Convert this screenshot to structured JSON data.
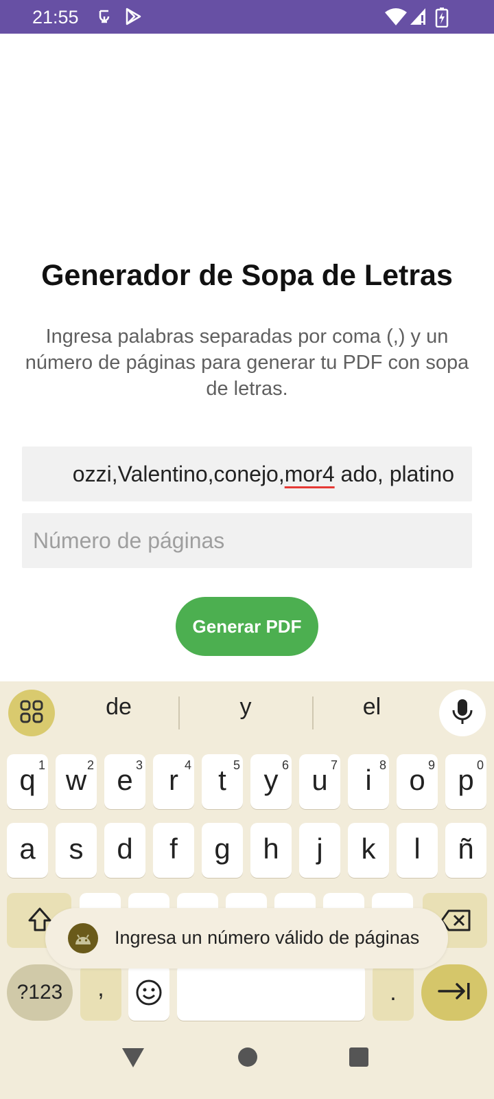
{
  "status_bar": {
    "time": "21:55"
  },
  "app": {
    "title": "Generador de Sopa de Letras",
    "subtitle": "Ingresa palabras separadas por coma (,) y un número de páginas para generar tu PDF con sopa de letras.",
    "words_input": {
      "value_pre": "ozzi,Valentino,conejo,",
      "value_underlined": "mor4",
      "value_post": " ado, platino"
    },
    "pages_input": {
      "placeholder": "Número de páginas",
      "value": ""
    },
    "generate_button": "Generar PDF"
  },
  "keyboard": {
    "suggestions": [
      "de",
      "y",
      "el"
    ],
    "row1": [
      {
        "char": "q",
        "num": "1"
      },
      {
        "char": "w",
        "num": "2"
      },
      {
        "char": "e",
        "num": "3"
      },
      {
        "char": "r",
        "num": "4"
      },
      {
        "char": "t",
        "num": "5"
      },
      {
        "char": "y",
        "num": "6"
      },
      {
        "char": "u",
        "num": "7"
      },
      {
        "char": "i",
        "num": "8"
      },
      {
        "char": "o",
        "num": "9"
      },
      {
        "char": "p",
        "num": "0"
      }
    ],
    "row2": [
      "a",
      "s",
      "d",
      "f",
      "g",
      "h",
      "j",
      "k",
      "l",
      "ñ"
    ],
    "sym_label": "?123",
    "comma": ",",
    "period": "."
  },
  "toast": {
    "text": "Ingresa un número válido de páginas"
  },
  "colors": {
    "status_bar": "#6750a4",
    "button": "#4caf50",
    "keyboard_bg": "#f2ecda",
    "accent_key": "#d5c66a"
  }
}
